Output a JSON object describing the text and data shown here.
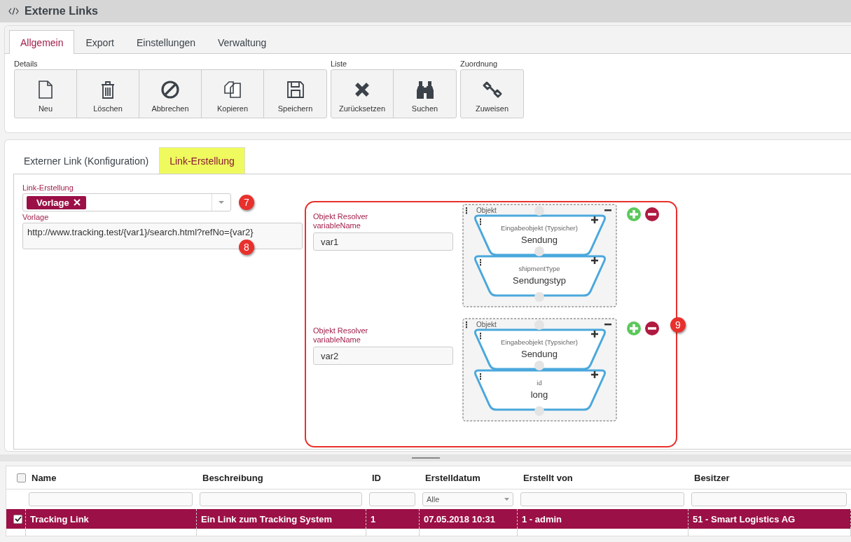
{
  "window": {
    "title": "Externe Links"
  },
  "tabs": [
    {
      "label": "Allgemein",
      "selected": true
    },
    {
      "label": "Export",
      "selected": false
    },
    {
      "label": "Einstellungen",
      "selected": false
    },
    {
      "label": "Verwaltung",
      "selected": false
    }
  ],
  "toolbar_groups": [
    {
      "label": "Details",
      "buttons": [
        "Neu",
        "Löschen",
        "Abbrechen",
        "Kopieren",
        "Speichern"
      ]
    },
    {
      "label": "Liste",
      "buttons": [
        "Zurücksetzen",
        "Suchen"
      ]
    },
    {
      "label": "Zuordnung",
      "buttons": [
        "Zuweisen"
      ]
    }
  ],
  "subtabs": [
    {
      "label": "Externer Link (Konfiguration)",
      "selected": false
    },
    {
      "label": "Link-Erstellung",
      "selected": true
    }
  ],
  "link_creation": {
    "label": "Link-Erstellung",
    "tags": [
      "Vorlage"
    ],
    "template_label": "Vorlage",
    "template_value": "http://www.tracking.test/{var1}/search.html?refNo={var2}"
  },
  "markers": [
    "7",
    "8",
    "9"
  ],
  "resolvers": [
    {
      "label": "Objekt Resolver variableName",
      "value": "var1",
      "group_label": "Objekt",
      "blocks": [
        {
          "caption": "Eingabeobjekt (Typsicher)",
          "title": "Sendung"
        },
        {
          "caption": "shipmentType",
          "title": "Sendungstyp"
        }
      ]
    },
    {
      "label": "Objekt Resolver variableName",
      "value": "var2",
      "group_label": "Objekt",
      "blocks": [
        {
          "caption": "Eingabeobjekt (Typsicher)",
          "title": "Sendung"
        },
        {
          "caption": "id",
          "title": "long"
        }
      ]
    }
  ],
  "table": {
    "columns": [
      "Name",
      "Beschreibung",
      "ID",
      "Erstelldatum",
      "Erstellt von",
      "Besitzer"
    ],
    "header_checked": false,
    "filters": [
      {
        "kind": "text"
      },
      {
        "kind": "text"
      },
      {
        "kind": "text"
      },
      {
        "kind": "select",
        "value": "Alle"
      },
      {
        "kind": "text"
      },
      {
        "kind": "text"
      }
    ],
    "rows": [
      {
        "checked": true,
        "selected": true,
        "cells": [
          "Tracking Link",
          "Ein Link zum Tracking System",
          "1",
          "07.05.2018 10:31",
          "1 - admin",
          "51 - Smart Logistics AG"
        ]
      }
    ]
  }
}
